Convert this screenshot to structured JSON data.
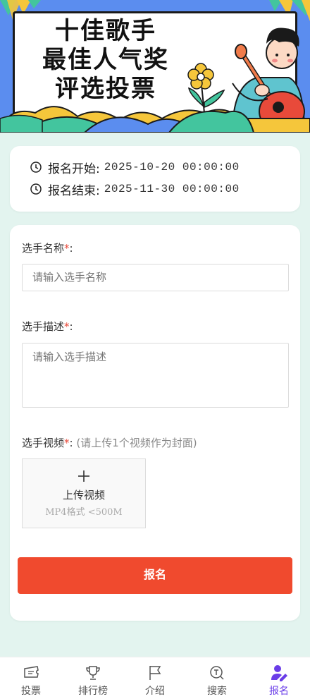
{
  "banner": {
    "title_line1": "十佳歌手",
    "title_line2": "最佳人气奖",
    "title_line3": "评选投票"
  },
  "schedule": {
    "start_label": "报名开始:",
    "start_value": "2025-10-20 00:00:00",
    "end_label": "报名结束:",
    "end_value": "2025-11-30 00:00:00"
  },
  "form": {
    "name_label": "选手名称",
    "name_placeholder": "请输入选手名称",
    "desc_label": "选手描述",
    "desc_placeholder": "请输入选手描述",
    "video_label": "选手视频",
    "required_mark": "*",
    "colon": ":",
    "video_hint": "(请上传1个视频作为封面)",
    "upload_title": "上传视频",
    "upload_sub": "MP4格式 <500M",
    "submit_label": "报名"
  },
  "tabbar": {
    "items": [
      {
        "label": "投票",
        "icon": "ticket-icon"
      },
      {
        "label": "排行榜",
        "icon": "trophy-icon"
      },
      {
        "label": "介绍",
        "icon": "flag-icon"
      },
      {
        "label": "搜索",
        "icon": "search-icon"
      },
      {
        "label": "报名",
        "icon": "user-edit-icon",
        "active": true
      }
    ]
  },
  "colors": {
    "accent": "#6a3de8",
    "submit": "#f04a2e",
    "background": "#e3f4ef",
    "banner_blue": "#5b8def"
  }
}
